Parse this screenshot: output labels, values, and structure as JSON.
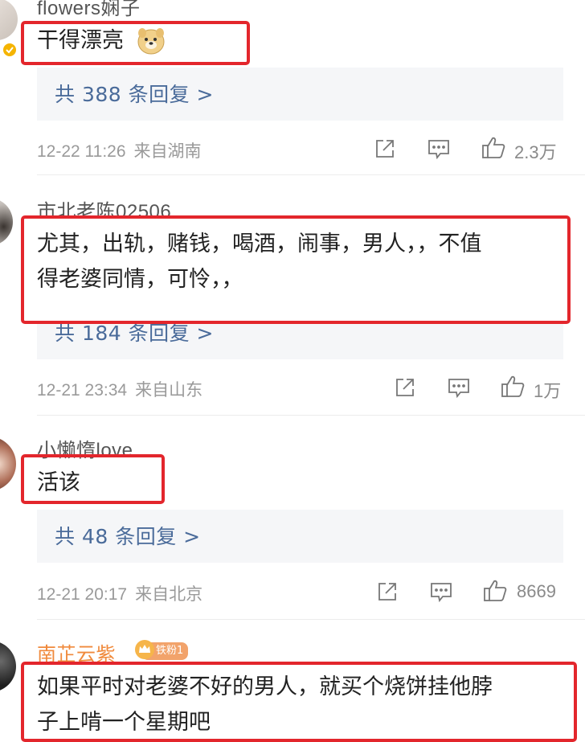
{
  "comments": [
    {
      "username": "flowers娴子",
      "content_lines": [
        "干得漂亮"
      ],
      "emoji": "doge-emoji",
      "reply_label": "共 388 条回复 >",
      "time": "12-22 11:26",
      "location": "来自湖南",
      "likes": "2.3万"
    },
    {
      "username": "市北老陈02506",
      "content_lines": [
        "尤其，出轨，赌钱，喝酒，闹事，男人，，不值",
        "得老婆同情，可怜，，"
      ],
      "reply_label": "共 184 条回复 >",
      "time": "12-21 23:34",
      "location": "来自山东",
      "likes": "1万"
    },
    {
      "username": "小懒惰love",
      "content_lines": [
        "活该"
      ],
      "reply_label": "共 48 条回复 >",
      "time": "12-21 20:17",
      "location": "来自北京",
      "likes": "8669"
    },
    {
      "username": "南芷云紫",
      "badge": "铁粉1",
      "content_lines": [
        "如果平时对老婆不好的男人，就买个烧饼挂他脖",
        "子上啃一个星期吧"
      ]
    }
  ],
  "icons": {
    "share": "share-icon",
    "comment": "comment-icon",
    "like": "thumbs-up-icon",
    "verified": "verified-badge-icon",
    "crown": "crown-icon"
  },
  "colors": {
    "highlight_box": "#e3262c",
    "reply_link": "#4a6b9a",
    "username_fan": "#f08a3c"
  }
}
